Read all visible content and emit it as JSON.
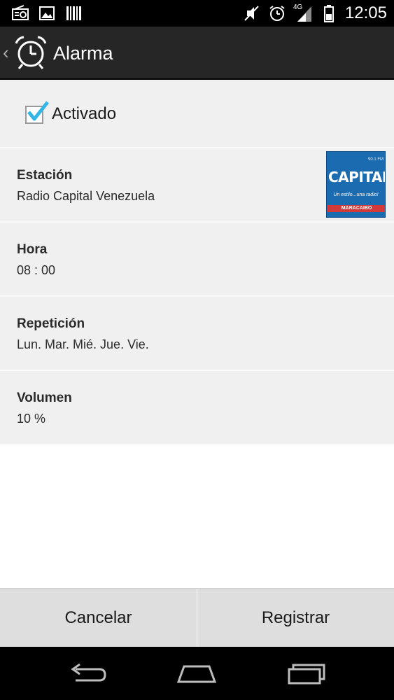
{
  "status_bar": {
    "time": "12:05",
    "network": "4G",
    "icons": [
      "radio-icon",
      "image-icon",
      "barcode-icon",
      "mute-icon",
      "alarm-icon",
      "signal-icon",
      "battery-icon"
    ]
  },
  "action_bar": {
    "title": "Alarma",
    "icon": "alarm-clock-icon"
  },
  "activado": {
    "label": "Activado",
    "checked": true
  },
  "items": [
    {
      "title": "Estación",
      "value": "Radio Capital Venezuela"
    },
    {
      "title": "Hora",
      "value": "08 : 00"
    },
    {
      "title": "Repetición",
      "value": "Lun. Mar. Mié. Jue. Vie."
    },
    {
      "title": "Volumen",
      "value": "10 %"
    }
  ],
  "station_logo": {
    "word": "CAPITAL",
    "small": "90.1 FM",
    "slogan": "Un estilo...una radio!",
    "band": "MARACAIBO"
  },
  "buttons": {
    "cancel": "Cancelar",
    "register": "Registrar"
  },
  "colors": {
    "action_bar": "#262626",
    "row_bg": "#f0f0f0",
    "check_accent": "#33b5e5",
    "button_bar": "#dedede"
  }
}
